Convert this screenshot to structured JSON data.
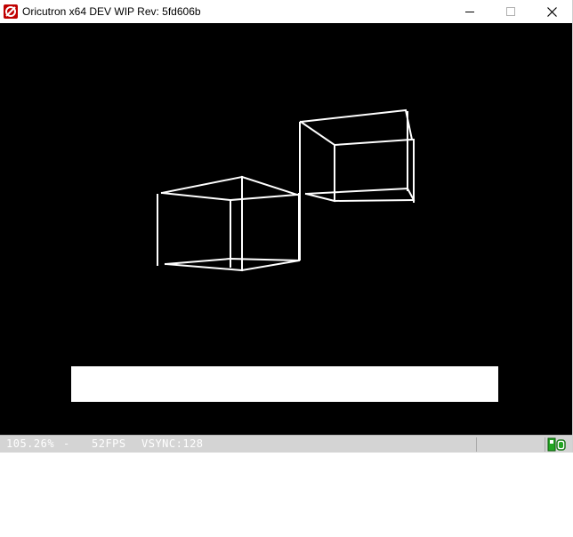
{
  "window": {
    "title": "Oricutron x64 DEV WIP Rev: 5fd606b",
    "icon": "oricutron-app-icon",
    "controls": {
      "minimize_icon": "minimize-icon",
      "maximize_icon": "maximize-icon",
      "close_icon": "close-icon"
    }
  },
  "status_bar": {
    "zoom": "105.26%",
    "separator": "-",
    "fps": "52FPS",
    "vsync": "VSYNC:128",
    "indicator_icon": "disk-activity-icon"
  },
  "colors": {
    "screen_background": "#000000",
    "wireframe": "#ffffff",
    "status_bar": "#d4d4d4",
    "status_text": "#ffffff",
    "indicator_green": "#22a522"
  }
}
